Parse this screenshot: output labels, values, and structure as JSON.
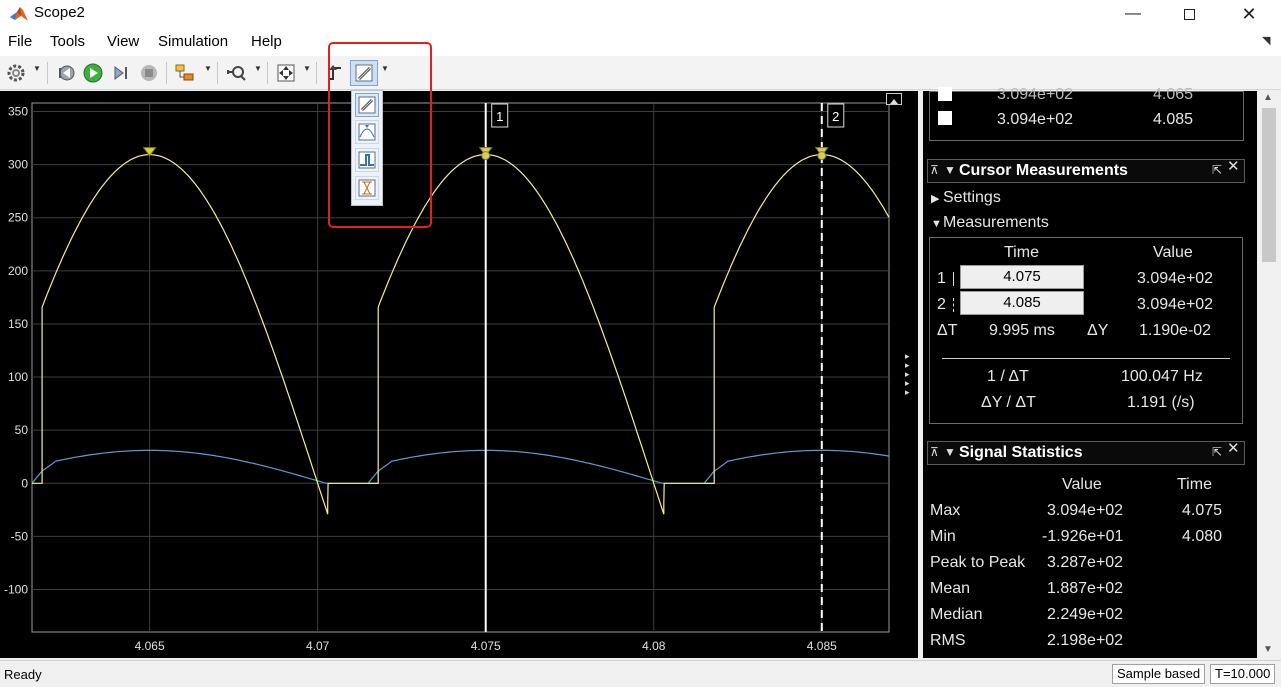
{
  "window": {
    "title": "Scope2"
  },
  "menu": [
    "File",
    "Tools",
    "View",
    "Simulation",
    "Help"
  ],
  "toolbar": {
    "buttons": [
      "gear-icon",
      "step-back-icon",
      "run-icon",
      "step-forward-icon",
      "stop-icon",
      "signal-selector-icon",
      "zoom-icon",
      "fit-to-view-icon",
      "triggers-icon",
      "cursor-measurements-icon"
    ],
    "cursor_menu": [
      "cursor-measurements-icon",
      "peak-finder-icon",
      "bilevel-measurements-icon",
      "signal-statistics-icon"
    ]
  },
  "plot": {
    "background": "#000000",
    "series_colors": [
      "#f5f08c",
      "#5b9bd5"
    ],
    "yticks": [
      "350",
      "300",
      "250",
      "200",
      "150",
      "100",
      "50",
      "0",
      "-50",
      "-100"
    ],
    "xticks": [
      "4.065",
      "4.07",
      "4.075",
      "4.08",
      "4.085"
    ],
    "cursor_labels": [
      "1",
      "2"
    ]
  },
  "chart_data": {
    "type": "line",
    "xlim": [
      4.0615,
      4.087
    ],
    "ylim": [
      -140,
      358
    ],
    "grid": true,
    "series": [
      {
        "color": "#f5f08c",
        "x": [
          4.0615,
          4.0618,
          4.0618,
          4.065,
          4.0703,
          4.0703,
          4.0718,
          4.0718,
          4.075,
          4.0803,
          4.0803,
          4.0818,
          4.0818,
          4.085,
          4.087
        ],
        "y": [
          0,
          0,
          155,
          309.4,
          0,
          -19.26,
          0,
          155,
          309.4,
          0,
          -19.26,
          0,
          155,
          309.4,
          250
        ]
      },
      {
        "color": "#5b9bd5",
        "x": [
          4.0615,
          4.0618,
          4.0622,
          4.065,
          4.0703,
          4.0718,
          4.0722,
          4.075,
          4.0803,
          4.0818,
          4.0822,
          4.085,
          4.087
        ],
        "y": [
          0,
          0,
          20,
          31,
          0,
          0,
          20,
          31,
          0,
          0,
          20,
          31,
          26
        ]
      }
    ],
    "markers": [
      4.065,
      4.075,
      4.085
    ],
    "cursors": [
      4.075,
      4.085
    ]
  },
  "legend_rows": [
    {
      "value": "3.094e+02",
      "time": "4.065"
    },
    {
      "value": "3.094e+02",
      "time": "4.085"
    }
  ],
  "cursor_panel": {
    "title": "Cursor Measurements",
    "settings": "Settings",
    "measurements": "Measurements",
    "col_time": "Time",
    "col_value": "Value",
    "row1_label": "1",
    "row1_time": "4.075",
    "row1_value": "3.094e+02",
    "row2_label": "2",
    "row2_time": "4.085",
    "row2_value": "3.094e+02",
    "dt_label": "ΔT",
    "dt_value": "9.995 ms",
    "dy_label": "ΔY",
    "dy_value": "1.190e-02",
    "inv_dt_label": "1 / ΔT",
    "inv_dt_value": "100.047 Hz",
    "dydt_label": "ΔY / ΔT",
    "dydt_value": "1.191 (/s)"
  },
  "stats_panel": {
    "title": "Signal Statistics",
    "col_value": "Value",
    "col_time": "Time",
    "rows": [
      {
        "label": "Max",
        "value": "3.094e+02",
        "time": "4.075"
      },
      {
        "label": "Min",
        "value": "-1.926e+01",
        "time": "4.080"
      },
      {
        "label": "Peak to Peak",
        "value": "3.287e+02",
        "time": ""
      },
      {
        "label": "Mean",
        "value": "1.887e+02",
        "time": ""
      },
      {
        "label": "Median",
        "value": "2.249e+02",
        "time": ""
      },
      {
        "label": "RMS",
        "value": "2.198e+02",
        "time": ""
      }
    ]
  },
  "status": {
    "text": "Ready",
    "mode": "Sample based",
    "time": "T=10.000"
  }
}
